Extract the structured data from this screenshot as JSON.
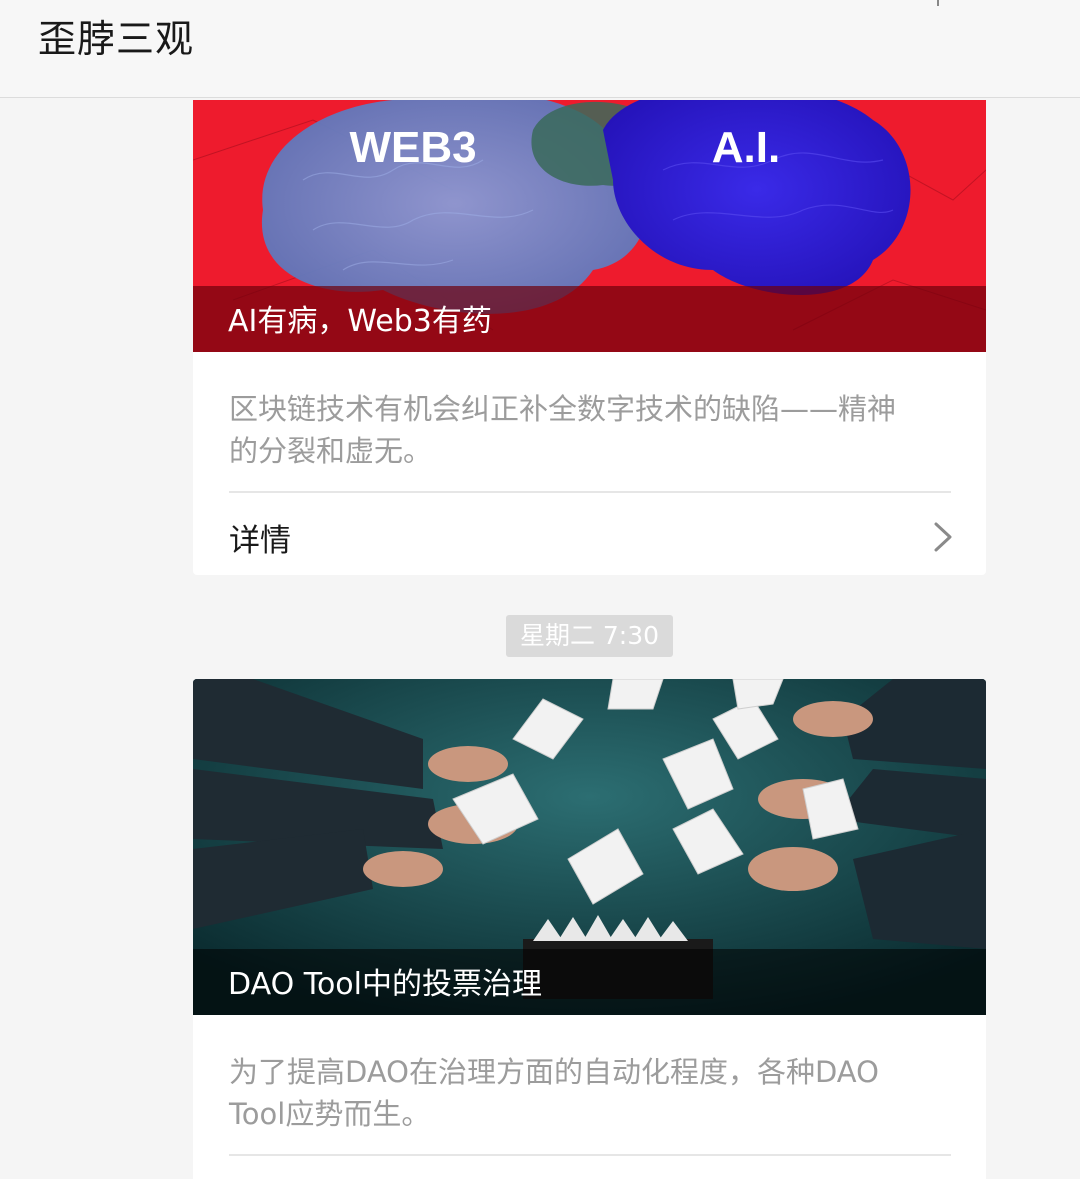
{
  "header": {
    "title": "歪脖三观"
  },
  "articles": [
    {
      "cover_labels": [
        "WEB3",
        "A.I."
      ],
      "title": "AI有病，Web3有药",
      "summary": "区块链技术有机会纠正补全数字技术的缺陷——精神的分裂和虚无。",
      "detail_label": "详情",
      "colors": {
        "background": "#ee1b2d",
        "brain_right": "#2a1ad8"
      }
    },
    {
      "title": "DAO Tool中的投票治理",
      "summary": "为了提高DAO在治理方面的自动化程度，各种DAO Tool应势而生。",
      "colors": {
        "background": "#0f3a40"
      }
    }
  ],
  "timestamp": "星期二 7:30",
  "icons": {
    "chevron": "chevron-right-icon"
  }
}
